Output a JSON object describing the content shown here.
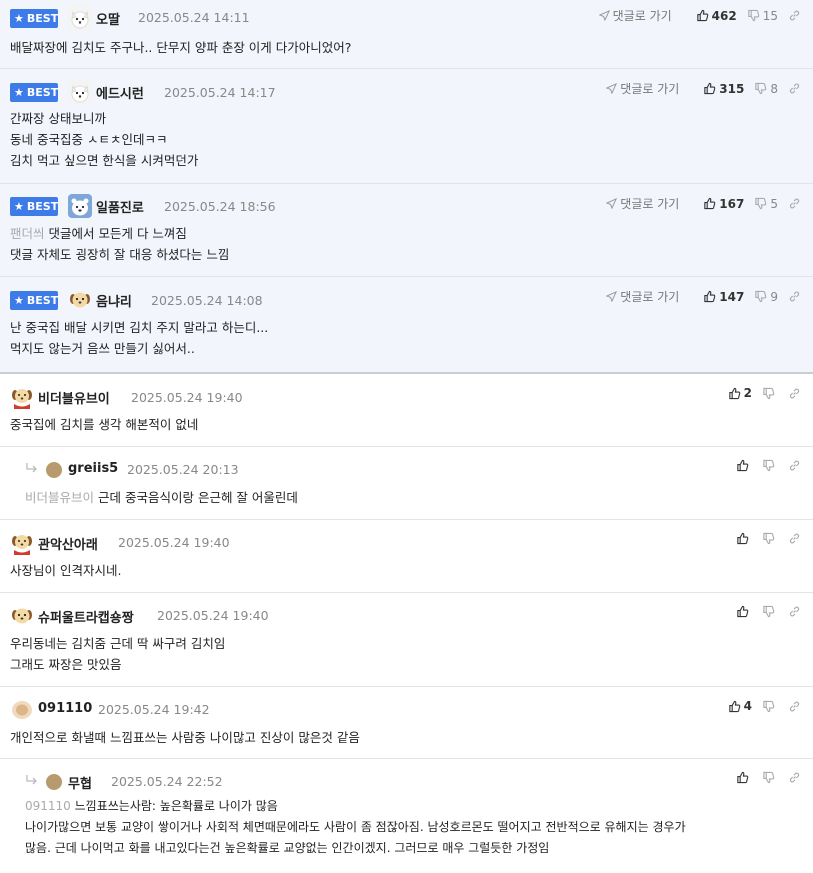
{
  "ui": {
    "best_label": "BEST",
    "goto_label": "댓글로 가기"
  },
  "best_comments": [
    {
      "nickname": "오딸",
      "date": "2025.05.24 14:11",
      "likes": "462",
      "dislikes": "15",
      "avatar": "white-dog",
      "lines": [
        "배달짜장에 김치도 주구나.. 단무지 양파 춘장 이게 다가아니었어?"
      ]
    },
    {
      "nickname": "에드시런",
      "date": "2025.05.24 14:17",
      "likes": "315",
      "dislikes": "8",
      "avatar": "white-dog",
      "lines": [
        "간짜장 상태보니까",
        "동네 중국집중 ㅅㅌㅊ인데ㅋㅋ",
        "김치 먹고 싶으면 한식을 시켜먹던가"
      ]
    },
    {
      "nickname": "일품진로",
      "date": "2025.05.24 18:56",
      "likes": "167",
      "dislikes": "5",
      "avatar": "bear",
      "mention": "팬더씌",
      "lines": [
        "댓글에서 모든게 다 느껴짐",
        "댓글 자체도 굉장히 잘 대응 하셨다는 느낌"
      ]
    },
    {
      "nickname": "음냐리",
      "date": "2025.05.24 14:08",
      "likes": "147",
      "dislikes": "9",
      "avatar": "puppy",
      "lines": [
        "난 중국집 배달 시키면 김치 주지 말라고 하는디...",
        "먹지도 않는거 음쓰 만들기 싫어서.."
      ]
    }
  ],
  "comments": [
    {
      "nickname": "비더블유브이",
      "date": "2025.05.24 19:40",
      "likes": "2",
      "avatar": "puppy-scarf",
      "lines": [
        "중국집에 김치를 생각 해본적이 없네"
      ]
    },
    {
      "reply": true,
      "nickname": "greiis5",
      "date": "2025.05.24 20:13",
      "likes": "",
      "mention": "비더블유브이",
      "lines": [
        "근데 중국음식이랑 은근헤 잘 어울린데"
      ]
    },
    {
      "nickname": "관악산아래",
      "date": "2025.05.24 19:40",
      "likes": "",
      "avatar": "puppy-scarf",
      "lines": [
        "사장님이 인격자시네."
      ]
    },
    {
      "nickname": "슈퍼울트라캡숑짱",
      "date": "2025.05.24 19:40",
      "likes": "",
      "avatar": "puppy",
      "lines": [
        "우리동네는 김치줌 근데 딱 싸구려 김치임",
        "그래도 짜장은 맛있음"
      ]
    },
    {
      "nickname": "091110",
      "date": "2025.05.24 19:42",
      "likes": "4",
      "avatar": "blur",
      "lines": [
        "개인적으로 화낼때 느낌표쓰는 사람중 나이많고 진상이 많은것 같음"
      ]
    },
    {
      "reply": true,
      "nickname": "무협",
      "date": "2025.05.24 22:52",
      "likes": "",
      "mention": "091110",
      "lines": [
        "느낌표쓰는사람: 높은확률로 나이가 많음",
        "나이가많으면 보통 교양이 쌓이거나 사회적 체면때문에라도 사람이 좀 점잖아짐. 남성호르몬도 떨어지고 전반적으로 유해지는 경우가",
        "많음. 근데 나이먹고 화를 내고있다는건 높은확률로 교양없는 인간이겠지. 그러므로 매우 그럴듯한 가정임"
      ]
    }
  ]
}
